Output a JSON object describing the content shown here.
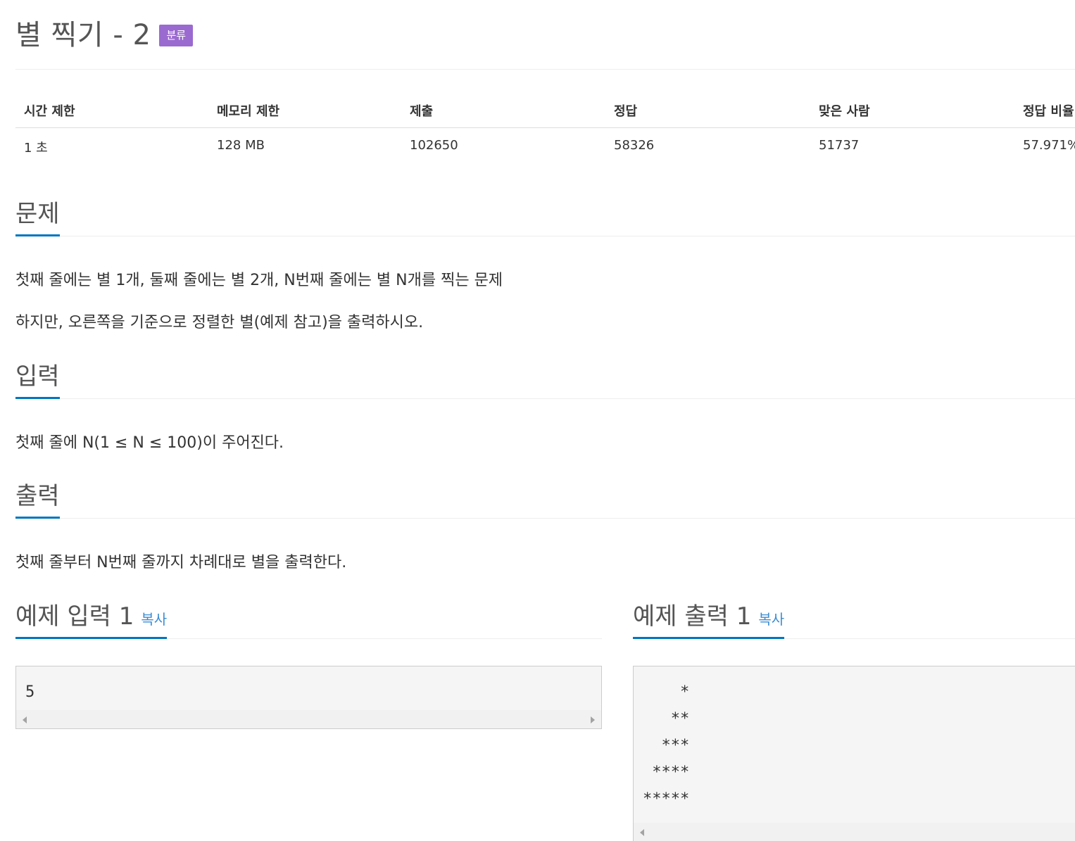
{
  "problem": {
    "title": "별 찍기 - 2",
    "badge": "분류"
  },
  "info": {
    "headers": [
      "시간 제한",
      "메모리 제한",
      "제출",
      "정답",
      "맞은 사람",
      "정답 비율"
    ],
    "values": [
      "1 초",
      "128 MB",
      "102650",
      "58326",
      "51737",
      "57.971%"
    ]
  },
  "sections": {
    "problem": {
      "heading": "문제",
      "lines": [
        "첫째 줄에는 별 1개, 둘째 줄에는 별 2개, N번째 줄에는 별 N개를 찍는 문제",
        "하지만, 오른쪽을 기준으로 정렬한 별(예제 참고)을 출력하시오."
      ]
    },
    "input": {
      "heading": "입력",
      "lines": [
        "첫째 줄에 N(1 ≤ N ≤ 100)이 주어진다."
      ]
    },
    "output": {
      "heading": "출력",
      "lines": [
        "첫째 줄부터 N번째 줄까지 차례대로 별을 출력한다."
      ]
    }
  },
  "samples": {
    "input": {
      "heading": "예제 입력 1",
      "copy_label": "복사",
      "content": "5"
    },
    "output": {
      "heading": "예제 출력 1",
      "copy_label": "복사",
      "content": "    *\n   **\n  ***\n ****\n*****"
    }
  },
  "colors": {
    "badge": "#9b6ad0",
    "accent_underline": "#0076c0",
    "link": "#3c8dd4"
  }
}
